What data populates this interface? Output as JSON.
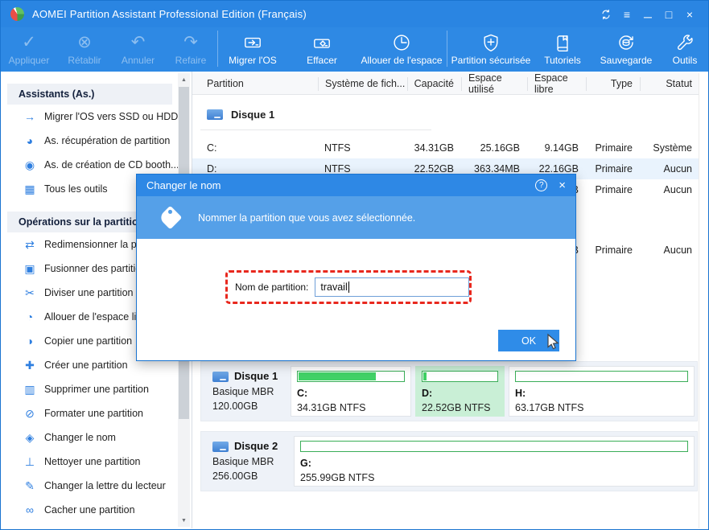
{
  "window": {
    "title": "AOMEI Partition Assistant Professional Edition (Français)"
  },
  "titlebar": {
    "menu_glyph": "≡",
    "minimize_glyph": "─",
    "maximize_glyph": "□",
    "close_glyph": "×"
  },
  "toolbar": {
    "items": [
      {
        "label": "Appliquer",
        "glyph": "✓",
        "enabled": false
      },
      {
        "label": "Rétablir",
        "glyph": "⊗",
        "enabled": false
      },
      {
        "label": "Annuler",
        "glyph": "↶",
        "enabled": false
      },
      {
        "label": "Refaire",
        "glyph": "↷",
        "enabled": false
      },
      {
        "label": "Migrer l'OS",
        "enabled": true
      },
      {
        "label": "Effacer",
        "enabled": true
      },
      {
        "label": "Allouer de l'espace",
        "enabled": true
      },
      {
        "label": "Partition sécurisée",
        "enabled": true
      },
      {
        "label": "Tutoriels",
        "enabled": true
      },
      {
        "label": "Sauvegarde",
        "enabled": true
      },
      {
        "label": "Outils",
        "enabled": true
      }
    ]
  },
  "sidebar": {
    "sections": [
      {
        "title": "Assistants (As.)",
        "items": [
          {
            "label": "Migrer l'OS vers SSD ou HDD",
            "icon": "migrate-disk-icon",
            "glyph": "→"
          },
          {
            "label": "As. récupération de partition",
            "icon": "partition-recovery-icon",
            "glyph": "◕"
          },
          {
            "label": "As. de création de CD booth...",
            "icon": "bootable-cd-icon",
            "glyph": "◉"
          },
          {
            "label": "Tous les outils",
            "icon": "all-tools-icon",
            "glyph": "▦"
          }
        ]
      },
      {
        "title": "Opérations sur la partition",
        "items": [
          {
            "label": "Redimensionner la partition",
            "icon": "resize-partition-icon",
            "glyph": "⇄"
          },
          {
            "label": "Fusionner des partitions",
            "icon": "merge-partitions-icon",
            "glyph": "▣"
          },
          {
            "label": "Diviser une partition",
            "icon": "split-partition-icon",
            "glyph": "✂"
          },
          {
            "label": "Allouer de l'espace libre",
            "icon": "allocate-free-space-icon",
            "glyph": "◔"
          },
          {
            "label": "Copier une partition",
            "icon": "copy-partition-icon",
            "glyph": "◑"
          },
          {
            "label": "Créer une partition",
            "icon": "create-partition-icon",
            "glyph": "✚"
          },
          {
            "label": "Supprimer une partition",
            "icon": "delete-partition-icon",
            "glyph": "▥"
          },
          {
            "label": "Formater une partition",
            "icon": "format-partition-icon",
            "glyph": "⊘"
          },
          {
            "label": "Changer le nom",
            "icon": "rename-tag-icon",
            "glyph": "◈"
          },
          {
            "label": "Nettoyer une partition",
            "icon": "wipe-partition-icon",
            "glyph": "⊥"
          },
          {
            "label": "Changer la lettre du lecteur",
            "icon": "change-letter-icon",
            "glyph": "✎"
          },
          {
            "label": "Cacher une partition",
            "icon": "hide-partition-icon",
            "glyph": "∞"
          }
        ]
      }
    ]
  },
  "table": {
    "columns": [
      "Partition",
      "Système de fich...",
      "Capacité",
      "Espace utilisé",
      "Espace libre",
      "Type",
      "Statut"
    ],
    "disks": [
      {
        "name": "Disque 1",
        "rows": [
          [
            "C:",
            "NTFS",
            "34.31GB",
            "25.16GB",
            "9.14GB",
            "Primaire",
            "Système"
          ],
          [
            "D:",
            "NTFS",
            "22.52GB",
            "363.34MB",
            "22.16GB",
            "Primaire",
            "Aucun"
          ],
          [
            "",
            "",
            "",
            "",
            "GB",
            "Primaire",
            "Aucun"
          ]
        ]
      },
      {
        "name": "Disque 2",
        "rows": [
          [
            "",
            "",
            "",
            "",
            "GB",
            "Primaire",
            "Aucun"
          ]
        ]
      }
    ]
  },
  "dialog": {
    "title": "Changer le nom",
    "help_glyph": "?",
    "close_glyph": "×",
    "message": "Nommer la partition que vous avez sélectionnée.",
    "field_label": "Nom de partition:",
    "field_value": "travail",
    "ok_label": "OK"
  },
  "panels": [
    {
      "name": "Disque 1",
      "type": "Basique MBR",
      "size": "120.00GB",
      "partitions": [
        {
          "name": "C:",
          "info": "34.31GB NTFS",
          "fill_pct": 73
        },
        {
          "name": "D:",
          "info": "22.52GB NTFS",
          "fill_pct": 4
        },
        {
          "name": "H:",
          "info": "63.17GB NTFS",
          "fill_pct": 0
        }
      ]
    },
    {
      "name": "Disque 2",
      "type": "Basique MBR",
      "size": "256.00GB",
      "partitions": [
        {
          "name": "G:",
          "info": "255.99GB NTFS",
          "fill_pct": 0
        }
      ]
    }
  ],
  "colors": {
    "titlebar_blue": "#2a85e2",
    "toolbar_blue": "#2e89e4",
    "dialog_band_blue": "#55a0e8",
    "ok_blue": "#2f8ce8",
    "bar_green": "#41d166",
    "selected_green": "#c9efd6",
    "row_highlight": "#e9f3fd",
    "annotation_red": "#e8281e"
  }
}
